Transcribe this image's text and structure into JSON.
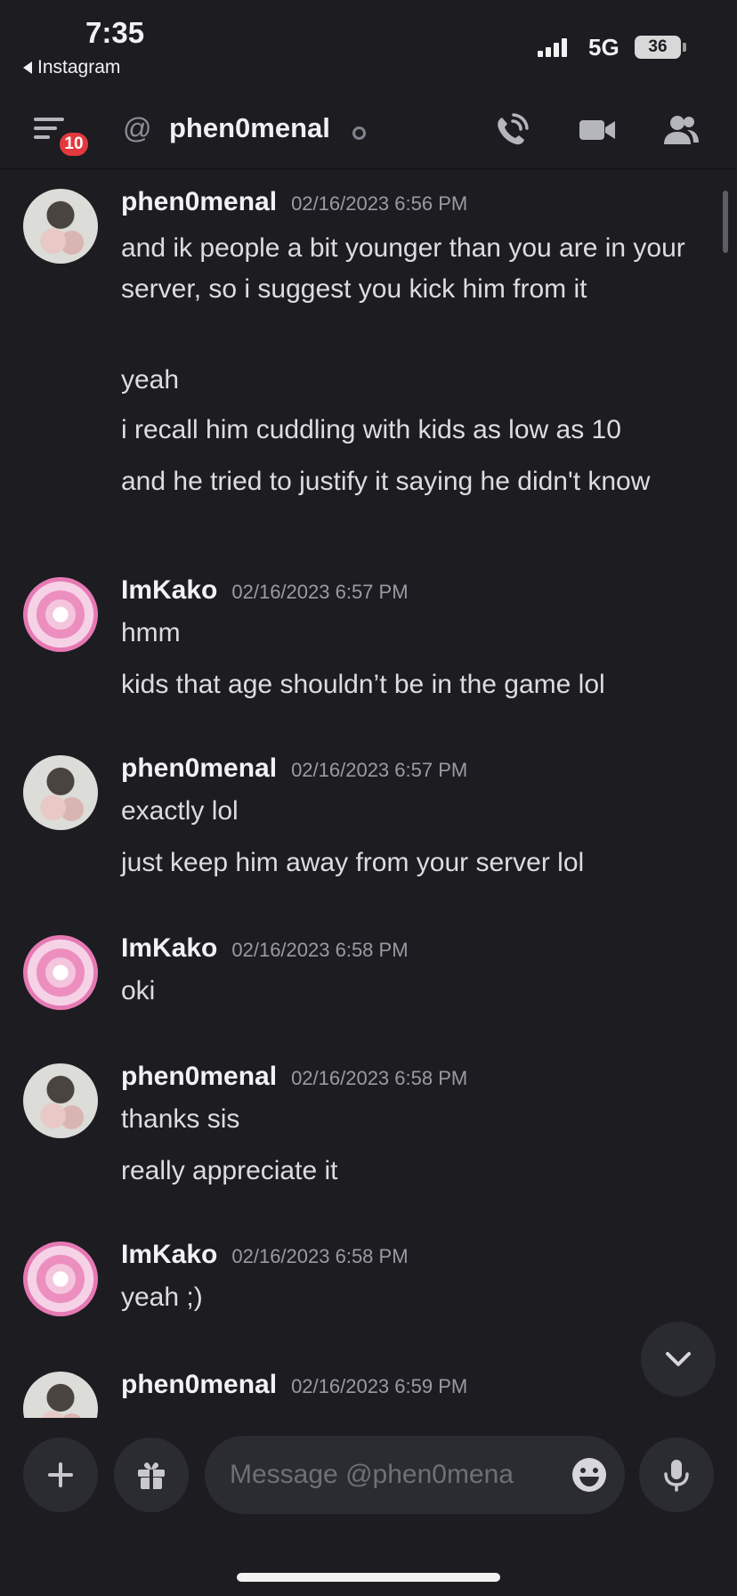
{
  "status_bar": {
    "time": "7:35",
    "back_app": "Instagram",
    "network": "5G",
    "battery": "36"
  },
  "header": {
    "badge_count": "10",
    "at_symbol": "@",
    "channel_name": "phen0menal"
  },
  "messages": [
    {
      "username": "phen0menal",
      "timestamp": "02/16/2023 6:56 PM",
      "avatar": "phen",
      "lines": [
        "and ik people a bit younger than you are in your server, so i suggest you kick him from it",
        "yeah",
        "i recall him cuddling with kids as low as 10",
        "and he tried to justify it saying he didn't know"
      ]
    },
    {
      "username": "ImKako",
      "timestamp": "02/16/2023 6:57 PM",
      "avatar": "kako",
      "lines": [
        "hmm",
        "kids that age shouldn’t be in the game lol"
      ]
    },
    {
      "username": "phen0menal",
      "timestamp": "02/16/2023 6:57 PM",
      "avatar": "phen",
      "lines": [
        "exactly lol",
        "just keep him away from your server lol"
      ]
    },
    {
      "username": "ImKako",
      "timestamp": "02/16/2023 6:58 PM",
      "avatar": "kako",
      "lines": [
        "oki"
      ]
    },
    {
      "username": "phen0menal",
      "timestamp": "02/16/2023 6:58 PM",
      "avatar": "phen",
      "lines": [
        "thanks sis",
        "really appreciate it"
      ]
    },
    {
      "username": "ImKako",
      "timestamp": "02/16/2023 6:58 PM",
      "avatar": "kako",
      "lines": [
        "yeah ;)"
      ]
    },
    {
      "username": "phen0menal",
      "timestamp": "02/16/2023 6:59 PM",
      "avatar": "phen",
      "lines": []
    }
  ],
  "composer": {
    "placeholder": "Message @phen0mena"
  },
  "icons": {
    "menu": "hamburger-icon",
    "call": "phone-call-icon",
    "video": "video-camera-icon",
    "members": "members-icon",
    "add": "plus-icon",
    "gift": "gift-icon",
    "emoji": "emoji-icon",
    "mic": "microphone-icon",
    "scroll_down": "chevron-down-icon"
  },
  "colors": {
    "background": "#1c1c21",
    "badge": "#e2393f",
    "input_bg": "#2b2b32"
  }
}
